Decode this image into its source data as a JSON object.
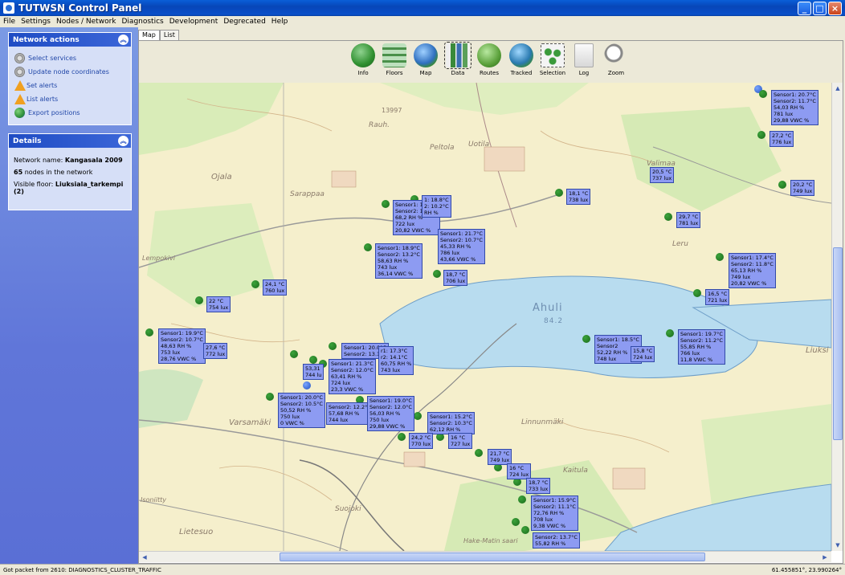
{
  "window": {
    "title": "TUTWSN Control Panel"
  },
  "menu": [
    "File",
    "Settings",
    "Nodes / Network",
    "Diagnostics",
    "Development",
    "Degrecated",
    "Help"
  ],
  "network_actions": {
    "title": "Network actions",
    "items": [
      {
        "label": "Select services",
        "icon": "gear-icon"
      },
      {
        "label": "Update node coordinates",
        "icon": "gear-icon"
      },
      {
        "label": "Set alerts",
        "icon": "warning-icon"
      },
      {
        "label": "List alerts",
        "icon": "warning-icon"
      },
      {
        "label": "Export positions",
        "icon": "globe-icon"
      }
    ]
  },
  "details": {
    "title": "Details",
    "network_label": "Network name:",
    "network_name": "Kangasala 2009",
    "node_count": "65",
    "node_suffix": "nodes in the network",
    "floor_label": "Visible floor:",
    "floor": "Liuksiala_tarkempi (2)"
  },
  "tabs": [
    "Map",
    "List"
  ],
  "toolbar": [
    {
      "label": "Info",
      "icon": "info-icon",
      "color": "#3a9a3a"
    },
    {
      "label": "Floors",
      "icon": "floors-icon",
      "color": "#6aa06a"
    },
    {
      "label": "Map",
      "icon": "map-icon",
      "color": "#3060b0"
    },
    {
      "label": "Data",
      "icon": "data-icon",
      "color": "#3a8a3a"
    },
    {
      "label": "Routes",
      "icon": "routes-icon",
      "color": "#4aa04a"
    },
    {
      "label": "Tracked",
      "icon": "tracked-icon",
      "color": "#2a7ab0"
    },
    {
      "label": "Selection",
      "icon": "selection-icon",
      "color": "#3a9a3a"
    },
    {
      "label": "Log",
      "icon": "log-icon",
      "color": "#cccccc"
    },
    {
      "label": "Zoom",
      "icon": "zoom-icon",
      "color": "#bbbbbb"
    }
  ],
  "map_places": [
    "Rauh.",
    "Peltola",
    "Uotila",
    "Ojala",
    "Sarappaa",
    "Lempokivi",
    "Ahuli",
    "84.2",
    "Varsamäki",
    "Linnunmäki",
    "Kaitula",
    "Lietesuo",
    "Suojoki",
    "Leru",
    "Liuksi",
    "Valimaa",
    "Isoniitty",
    "Hake-Matin saari",
    "13997"
  ],
  "sensor_labels": [
    {
      "text": "Sensor1: 20.7°C\nSensor2: 11.7°C\n54,03 RH %\n781 lux\n29,88 VWC %"
    },
    {
      "text": "27,2 °C\n776 lux"
    },
    {
      "text": "20,5 °C\n737 lux"
    },
    {
      "text": "20,2 °C\n749 lux"
    },
    {
      "text": "18,1 °C\n738 lux"
    },
    {
      "text": "29,7 °C\n781 lux"
    },
    {
      "text": "Sensor1: 16.0°C\nSensor2: 10.2°C\n68,2 RH %\n722 lux\n20,82 VWC %"
    },
    {
      "text": "1: 18.8°C\n2: 10.2°C\nRH %"
    },
    {
      "text": "Sensor1: 21.7°C\nSensor2: 10.7°C\n45,33 RH %\n786 lux\n43,66 VWC %"
    },
    {
      "text": "Sensor1: 18.9°C\nSensor2: 13.2°C\n58,63 RH %\n743 lux\n36,14 VWC %"
    },
    {
      "text": "18,7 °C\n706 lux"
    },
    {
      "text": "Sensor1: 17.4°C\nSensor2: 11.8°C\n65,13 RH %\n749 lux\n20,82 VWC %"
    },
    {
      "text": "24,1 °C\n760 lux"
    },
    {
      "text": "16,5 °C\n721 lux"
    },
    {
      "text": "22 °C\n754 lux"
    },
    {
      "text": "Sensor1: 19.9°C\nSensor2: 10.7°C\n48,63 RH %\n753 lux\n28,76 VWC %"
    },
    {
      "text": "27,6 °C\n772 lux"
    },
    {
      "text": "Sensor1: 20.0°C\nSensor2: 13.1°C"
    },
    {
      "text": "r1: 17.3°C\nr2: 14.1°C\n60,75 RH %\n743 lux"
    },
    {
      "text": "Sensor1: 18.5°C\nSensor2\n52,22 RH %\n748 lux"
    },
    {
      "text": "15,8 °C\n724 lux"
    },
    {
      "text": "Sensor1: 19.7°C\nSensor2: 11.2°C\n55,85 RH %\n766 lux\n11,8 VWC %"
    },
    {
      "text": "53,31\n744 lu"
    },
    {
      "text": "Sensor1: 21.3°C\nSensor2: 12.0°C\n63,41 RH %\n724 lux\n23,3 VWC %"
    },
    {
      "text": "Sensor1: 20.0°C\nSensor2: 10.5°C\n50,52 RH %\n750 lux\n0 VWC %"
    },
    {
      "text": "Sensor2: 12.2°C\n57,68 RH %\n744 lux"
    },
    {
      "text": "Sensor1: 19.0°C\nSensor2: 12.0°C\n56,03 RH %\n750 lux\n29,88 VWC %"
    },
    {
      "text": "Sensor1: 15.2°C\nSensor2: 10.3°C\n62,12 RH %"
    },
    {
      "text": "24,2 °C\n770 lux"
    },
    {
      "text": "16 °C\n727 lux"
    },
    {
      "text": "21,7 °C\n749 lux"
    },
    {
      "text": "16 °C\n724 lux"
    },
    {
      "text": "18,7 °C\n733 lux"
    },
    {
      "text": "Sensor1: 15.9°C\nSensor2: 11.1°C\n72,76 RH %\n708 lux\n9,38 VWC %"
    },
    {
      "text": "Sensor2: 13.7°C\n55,82 RH %"
    }
  ],
  "status": {
    "message": "Got packet from 2610: DIAGNOSTICS_CLUSTER_TRAFFIC",
    "coords": "61.455851°, 23.990264°"
  }
}
